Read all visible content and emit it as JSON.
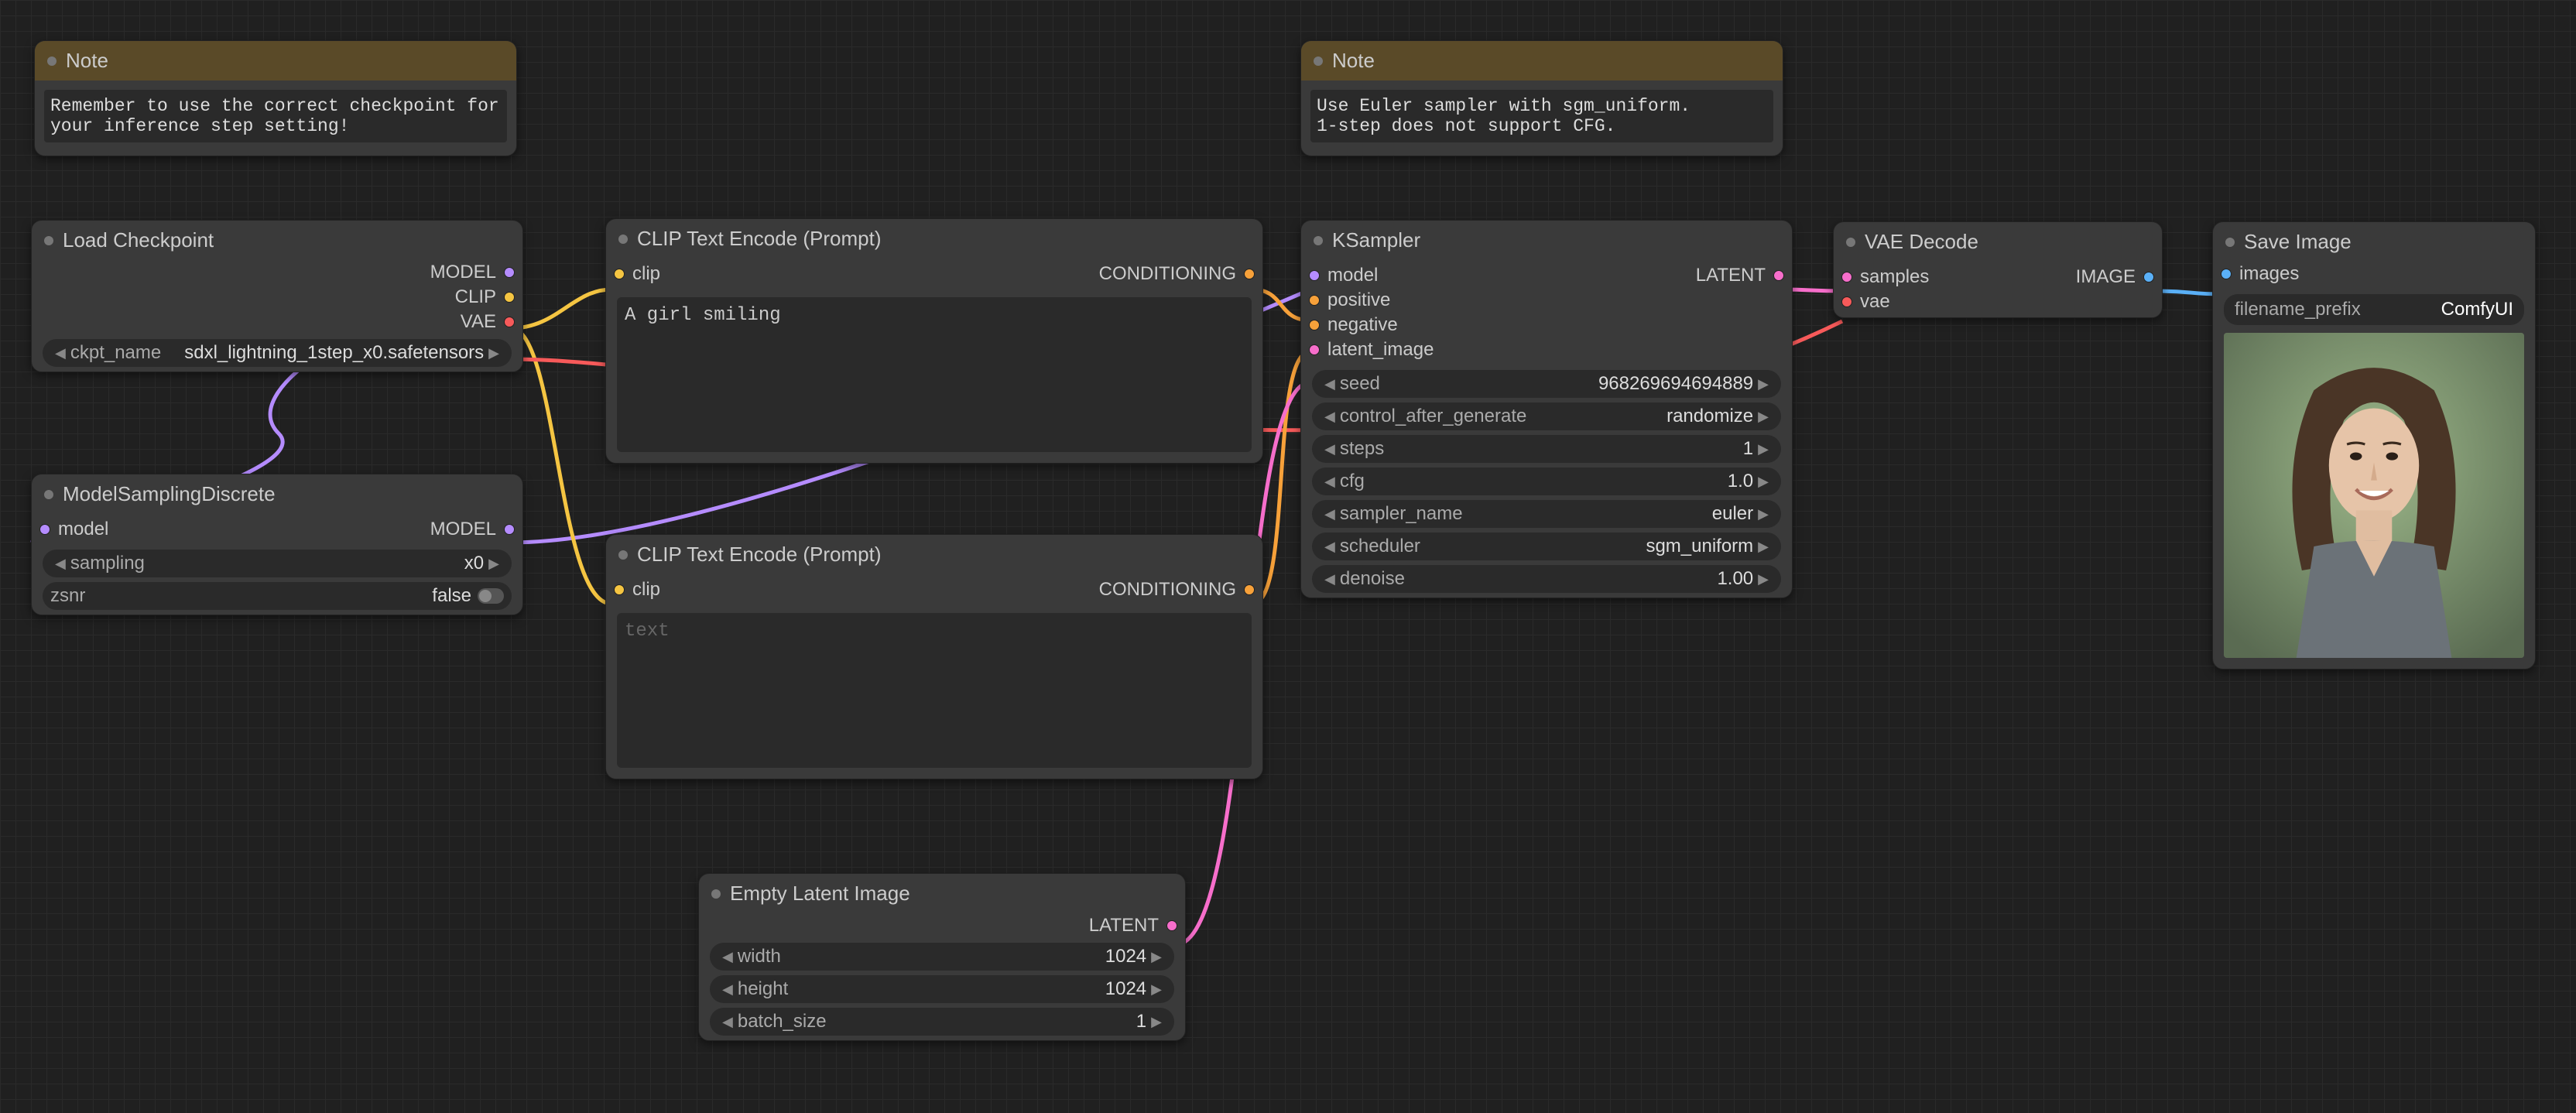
{
  "notes": {
    "n1": {
      "title": "Note",
      "text": "Remember to use the correct checkpoint for your inference step setting!"
    },
    "n2": {
      "title": "Note",
      "text": "Use Euler sampler with sgm_uniform.\n1-step does not support CFG."
    }
  },
  "load_ckpt": {
    "title": "Load Checkpoint",
    "out_model": "MODEL",
    "out_clip": "CLIP",
    "out_vae": "VAE",
    "widget_label": "ckpt_name",
    "widget_value": "sdxl_lightning_1step_x0.safetensors"
  },
  "model_sampling": {
    "title": "ModelSamplingDiscrete",
    "in_model": "model",
    "out_model": "MODEL",
    "sampling_label": "sampling",
    "sampling_value": "x0",
    "zsnr_label": "zsnr",
    "zsnr_value": "false"
  },
  "clip_pos": {
    "title": "CLIP Text Encode (Prompt)",
    "in_clip": "clip",
    "out_cond": "CONDITIONING",
    "text": "A girl smiling"
  },
  "clip_neg": {
    "title": "CLIP Text Encode (Prompt)",
    "in_clip": "clip",
    "out_cond": "CONDITIONING",
    "placeholder": "text"
  },
  "empty_latent": {
    "title": "Empty Latent Image",
    "out_latent": "LATENT",
    "width_label": "width",
    "width_value": "1024",
    "height_label": "height",
    "height_value": "1024",
    "batch_label": "batch_size",
    "batch_value": "1"
  },
  "ksampler": {
    "title": "KSampler",
    "in_model": "model",
    "in_positive": "positive",
    "in_negative": "negative",
    "in_latent": "latent_image",
    "out_latent": "LATENT",
    "seed_label": "seed",
    "seed_value": "968269694694889",
    "cag_label": "control_after_generate",
    "cag_value": "randomize",
    "steps_label": "steps",
    "steps_value": "1",
    "cfg_label": "cfg",
    "cfg_value": "1.0",
    "sampler_label": "sampler_name",
    "sampler_value": "euler",
    "scheduler_label": "scheduler",
    "scheduler_value": "sgm_uniform",
    "denoise_label": "denoise",
    "denoise_value": "1.00"
  },
  "vae_decode": {
    "title": "VAE Decode",
    "in_samples": "samples",
    "in_vae": "vae",
    "out_image": "IMAGE"
  },
  "save_image": {
    "title": "Save Image",
    "in_images": "images",
    "prefix_label": "filename_prefix",
    "prefix_value": "ComfyUI"
  },
  "colors": {
    "model": "#b58cff",
    "clip": "#f5c542",
    "vae": "#f75a5a",
    "cond": "#f7a13a",
    "latent": "#f76ecb",
    "image": "#5ab0f7"
  }
}
